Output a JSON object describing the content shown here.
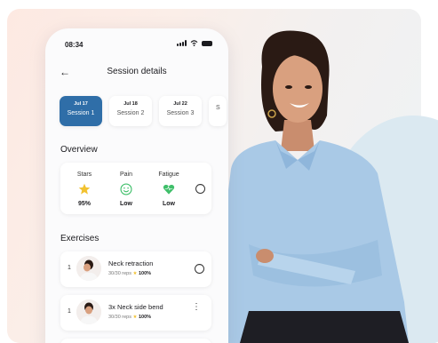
{
  "status_bar": {
    "time": "08:34"
  },
  "header": {
    "title": "Session details"
  },
  "sessions": [
    {
      "date": "Jul 17",
      "label": "Session 1",
      "active": true
    },
    {
      "date": "Jul 18",
      "label": "Session 2",
      "active": false
    },
    {
      "date": "Jul 22",
      "label": "Session 3",
      "active": false
    },
    {
      "date": "",
      "label": "S",
      "active": false
    }
  ],
  "overview": {
    "heading": "Overview",
    "stats": [
      {
        "label": "Stars",
        "value": "95%",
        "icon": "star-icon"
      },
      {
        "label": "Pain",
        "value": "Low",
        "icon": "smiley-icon"
      },
      {
        "label": "Fatigue",
        "value": "Low",
        "icon": "heart-icon"
      }
    ]
  },
  "exercises": {
    "heading": "Exercises",
    "items": [
      {
        "num": "1",
        "name": "Neck retraction",
        "reps": "30/30 reps",
        "score": "100%"
      },
      {
        "num": "1",
        "name": "3x Neck side bend",
        "reps": "30/30 reps",
        "score": "100%"
      }
    ]
  },
  "colors": {
    "accent": "#2f6ea8",
    "star": "#f2c230",
    "green": "#3fbf6a"
  }
}
